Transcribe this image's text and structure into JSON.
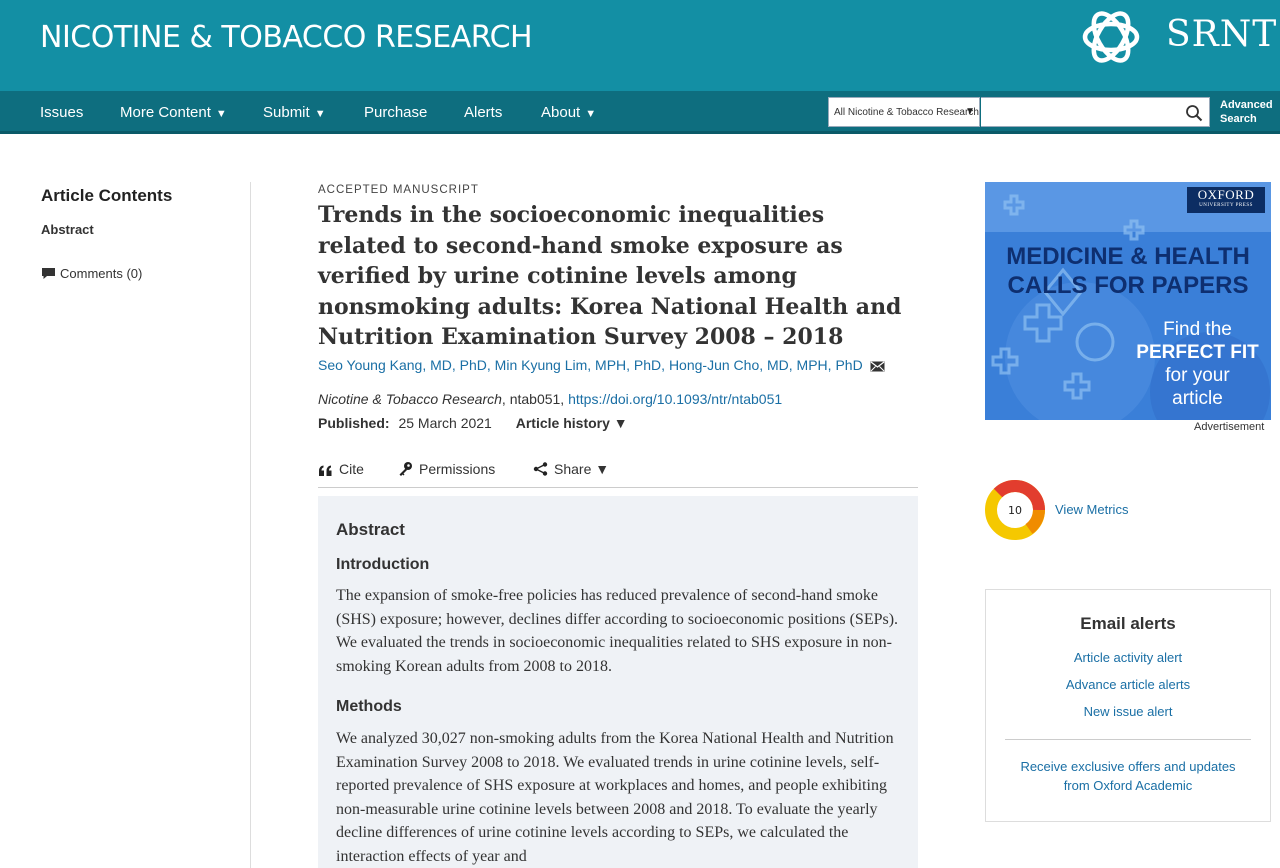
{
  "header": {
    "journal_title": "NICOTINE & TOBACCO RESEARCH",
    "society": "SRNT"
  },
  "nav": {
    "items": [
      {
        "label": "Issues",
        "has_dropdown": false
      },
      {
        "label": "More Content",
        "has_dropdown": true
      },
      {
        "label": "Submit",
        "has_dropdown": true
      },
      {
        "label": "Purchase",
        "has_dropdown": false
      },
      {
        "label": "Alerts",
        "has_dropdown": false
      },
      {
        "label": "About",
        "has_dropdown": true
      }
    ],
    "caret": "▼",
    "search_scope": "All Nicotine & Tobacco Research",
    "search_value": "",
    "advanced_line1": "Advanced",
    "advanced_line2": "Search"
  },
  "sidebar": {
    "title": "Article Contents",
    "items": [
      {
        "label": "Abstract"
      },
      {
        "label": "Comments (0)"
      }
    ]
  },
  "article": {
    "type": "ACCEPTED MANUSCRIPT",
    "title": "Trends in the socioeconomic inequalities related to second-hand smoke exposure as verified by urine cotinine levels among nonsmoking adults: Korea National Health and Nutrition Examination Survey 2008 – 2018",
    "authors": "Seo Young Kang, MD, PhD, Min Kyung Lim, MPH, PhD, Hong-Jun Cho, MD, MPH, PhD",
    "journal": "Nicotine & Tobacco Research",
    "article_id": ", ntab051, ",
    "doi": "https://doi.org/10.1093/ntr/ntab051",
    "published_label": "Published:",
    "published_date": "25 March 2021",
    "history_label": "Article history ▼",
    "tools": {
      "cite": "Cite",
      "permissions": "Permissions",
      "share": "Share ▼"
    }
  },
  "abstract": {
    "heading": "Abstract",
    "sections": [
      {
        "heading": "Introduction",
        "text": "The expansion of smoke-free policies has reduced prevalence of second-hand smoke (SHS) exposure; however, declines differ according to socioeconomic positions (SEPs). We evaluated the trends in socioeconomic inequalities related to SHS exposure in non-smoking Korean adults from 2008 to 2018."
      },
      {
        "heading": "Methods",
        "text": "We analyzed 30,027 non-smoking adults from the Korea National Health and Nutrition Examination Survey 2008 to 2018. We evaluated trends in urine cotinine levels, self-reported prevalence of SHS exposure at workplaces and homes, and people exhibiting non-measurable urine cotinine levels between 2008 and 2018. To evaluate the yearly decline differences of urine cotinine levels according to SEPs, we calculated the interaction effects of year and"
      }
    ]
  },
  "ad": {
    "brand": "OXFORD",
    "brand_sub": "UNIVERSITY PRESS",
    "headline_1": "MEDICINE & HEALTH",
    "headline_2": "CALLS FOR PAPERS",
    "cta_1": "Find the",
    "cta_2": "PERFECT FIT",
    "cta_3": "for your",
    "cta_4": "article",
    "label": "Advertisement"
  },
  "metrics": {
    "score": "10",
    "link": "View Metrics"
  },
  "email_alerts": {
    "title": "Email alerts",
    "links": [
      {
        "label": "Article activity alert"
      },
      {
        "label": "Advance article alerts"
      },
      {
        "label": "New issue alert"
      }
    ],
    "offers_line1": "Receive exclusive offers and updates",
    "offers_line2": "from Oxford Academic"
  },
  "colors": {
    "header_bg": "#138fa4",
    "nav_bg": "#0e6e7f",
    "link": "#1a6fa5",
    "abstract_bg": "#eff2f6"
  }
}
